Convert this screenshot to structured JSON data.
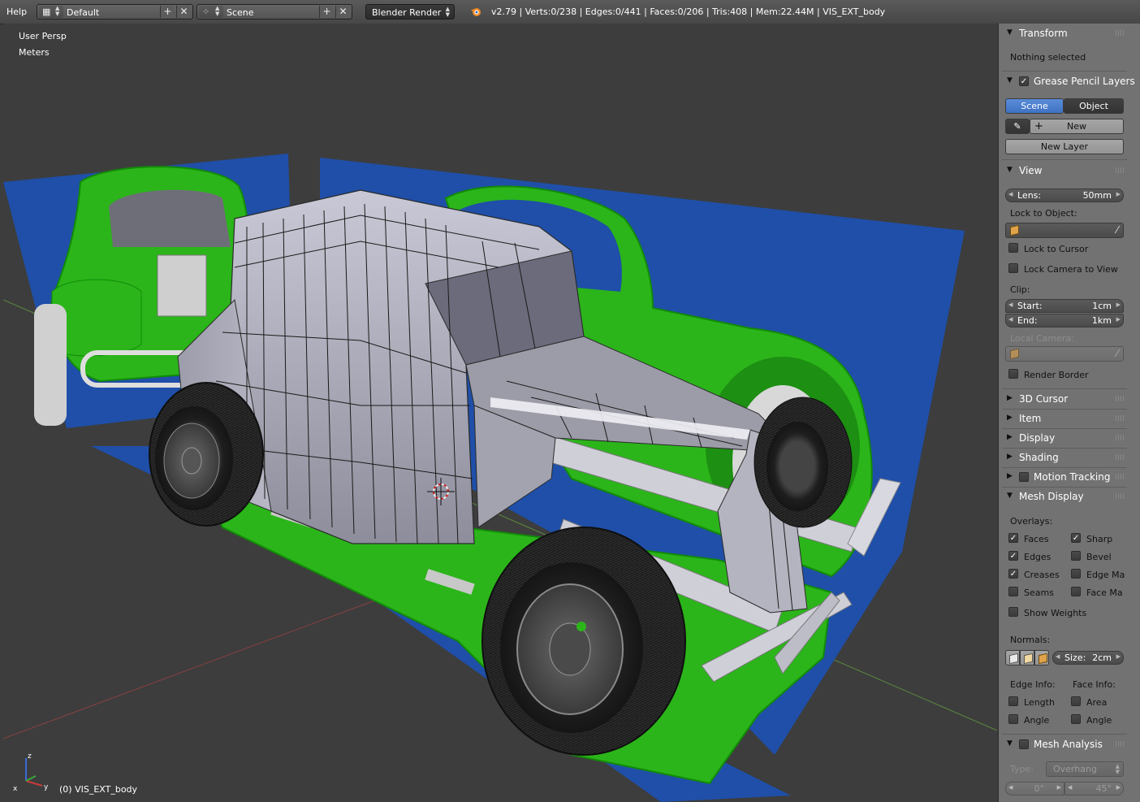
{
  "header": {
    "help_menu": "Help",
    "screen_layout": "Default",
    "scene_name": "Scene",
    "render_engine": "Blender Render",
    "stats": "v2.79 | Verts:0/238 | Edges:0/441 | Faces:0/206 | Tris:408 | Mem:22.44M | VIS_EXT_body"
  },
  "viewport": {
    "view_name": "User Persp",
    "units": "Meters",
    "object_label": "(0) VIS_EXT_body",
    "colors": {
      "background": "#3d3d3d",
      "blueprint": "#1f4fa8",
      "green_body": "#2bb51a",
      "grey_mesh": "#a9a9b8"
    }
  },
  "panel": {
    "transform": {
      "title": "Transform",
      "status": "Nothing selected"
    },
    "grease_pencil": {
      "title": "Grease Pencil Layers",
      "tab_scene": "Scene",
      "tab_object": "Object",
      "new_label": "New",
      "new_layer_label": "New Layer"
    },
    "view": {
      "title": "View",
      "lens_label": "Lens:",
      "lens_value": "50mm",
      "lock_to_object": "Lock to Object:",
      "lock_to_cursor": "Lock to Cursor",
      "lock_camera_to_view": "Lock Camera to View",
      "clip_label": "Clip:",
      "clip_start_label": "Start:",
      "clip_start_value": "1cm",
      "clip_end_label": "End:",
      "clip_end_value": "1km",
      "local_camera": "Local Camera:",
      "render_border": "Render Border"
    },
    "collapsed_sections": [
      "3D Cursor",
      "Item",
      "Display",
      "Shading",
      "Motion Tracking"
    ],
    "mesh_display": {
      "title": "Mesh Display",
      "overlays_label": "Overlays:",
      "faces": "Faces",
      "sharp": "Sharp",
      "edges": "Edges",
      "bevel": "Bevel",
      "creases": "Creases",
      "edge_marks": "Edge Ma",
      "seams": "Seams",
      "face_marks": "Face Ma",
      "show_weights": "Show Weights",
      "normals_label": "Normals:",
      "normals_size_label": "Size:",
      "normals_size_value": "2cm",
      "edge_info_label": "Edge Info:",
      "face_info_label": "Face Info:",
      "edge_length": "Length",
      "edge_angle": "Angle",
      "face_area": "Area",
      "face_angle": "Angle"
    },
    "mesh_analysis": {
      "title": "Mesh Analysis",
      "type_label": "Type:",
      "type_value": "Overhang",
      "min_value": "0°",
      "max_value": "45°"
    }
  }
}
